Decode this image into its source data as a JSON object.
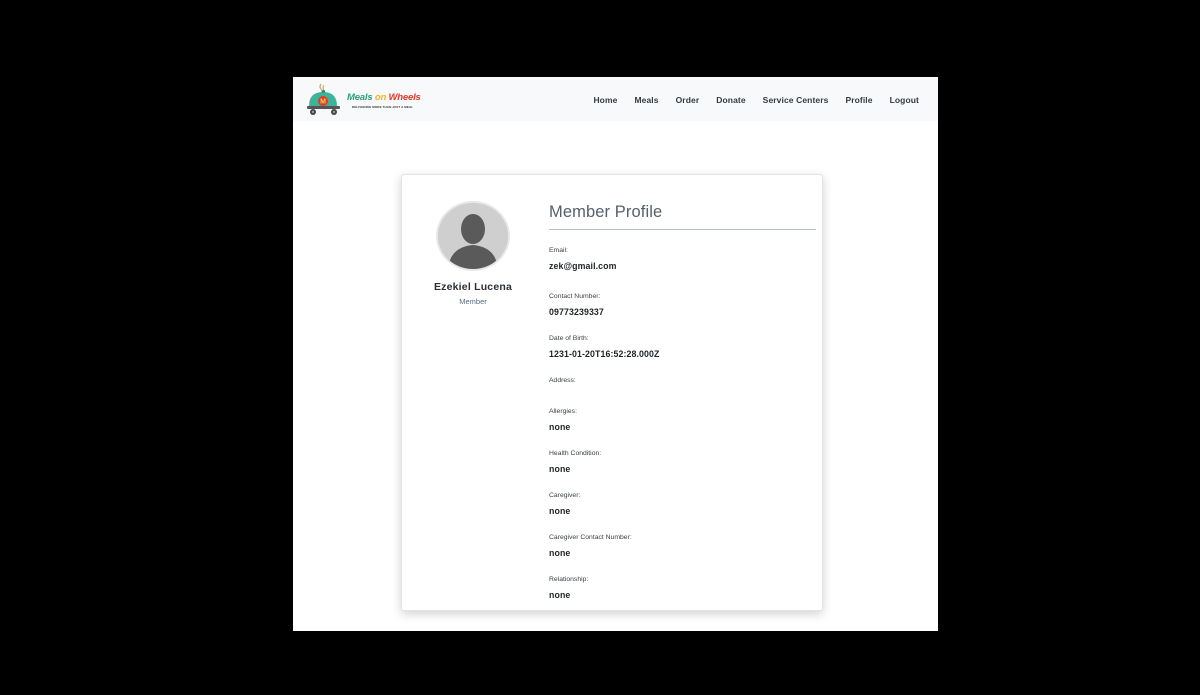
{
  "navbar": {
    "brand": {
      "name_part1": "Meals",
      "name_part2": "on",
      "name_part3": "Wheels",
      "tagline": "DELIVERING MORE THAN JUST A MEAL",
      "logo_letter": "M"
    },
    "links": [
      "Home",
      "Meals",
      "Order",
      "Donate",
      "Service Centers",
      "Profile",
      "Logout"
    ]
  },
  "profile": {
    "name": "Ezekiel Lucena",
    "role": "Member",
    "title": "Member Profile",
    "fields": [
      {
        "label": "Email:",
        "value": "zek@gmail.com"
      },
      {
        "label": "Contact Number:",
        "value": "09773239337"
      },
      {
        "label": "Date of Birth:",
        "value": "1231-01-20T16:52:28.000Z"
      },
      {
        "label": "Address:",
        "value": ""
      },
      {
        "label": "Allergies:",
        "value": "none"
      },
      {
        "label": "Health Condition:",
        "value": "none"
      },
      {
        "label": "Caregiver:",
        "value": "none"
      },
      {
        "label": "Caregiver Contact Number:",
        "value": "none"
      },
      {
        "label": "Relationship:",
        "value": "none"
      }
    ]
  },
  "colors": {
    "brand_green": "#2e9e7a",
    "brand_yellow": "#f2b416",
    "brand_red": "#e0392b",
    "navbar_bg": "#f8f9fa",
    "title_text": "#56606b"
  },
  "icons": {
    "logo": "food-cart-logo-icon",
    "avatar": "default-user-silhouette-icon"
  }
}
